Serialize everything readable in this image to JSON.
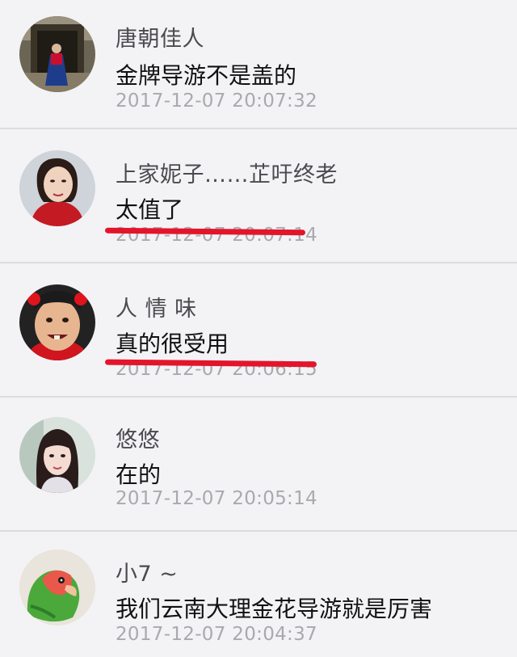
{
  "comments": [
    {
      "name": "唐朝佳人",
      "message": "金牌导游不是盖的",
      "time": "2017-12-07 20:07:32",
      "avatar": "avatar-woman-temple-red-dress",
      "underlined": false
    },
    {
      "name": "上家妮子……芷吁终老",
      "message": "太值了",
      "time": "2017-12-07 20:07:14",
      "avatar": "avatar-woman-portrait-red",
      "underlined": true
    },
    {
      "name": "人 情 味",
      "message": "真的很受用",
      "time": "2017-12-07 20:06:15",
      "avatar": "avatar-funny-face-red-bows",
      "underlined": true
    },
    {
      "name": "悠悠",
      "message": "在的",
      "time": "2017-12-07 20:05:14",
      "avatar": "avatar-girl-long-hair",
      "underlined": false
    },
    {
      "name": "小7 ~",
      "message": "我们云南大理金花导游就是厉害",
      "time": "2017-12-07 20:04:37",
      "avatar": "avatar-parrot-green",
      "underlined": false
    }
  ],
  "colors": {
    "background": "#f3f3f5",
    "divider": "#dcdcdf",
    "name_text": "#4b4b4f",
    "message_text": "#111114",
    "time_text": "#a9a9ae",
    "annotation_red": "#e3152b"
  }
}
